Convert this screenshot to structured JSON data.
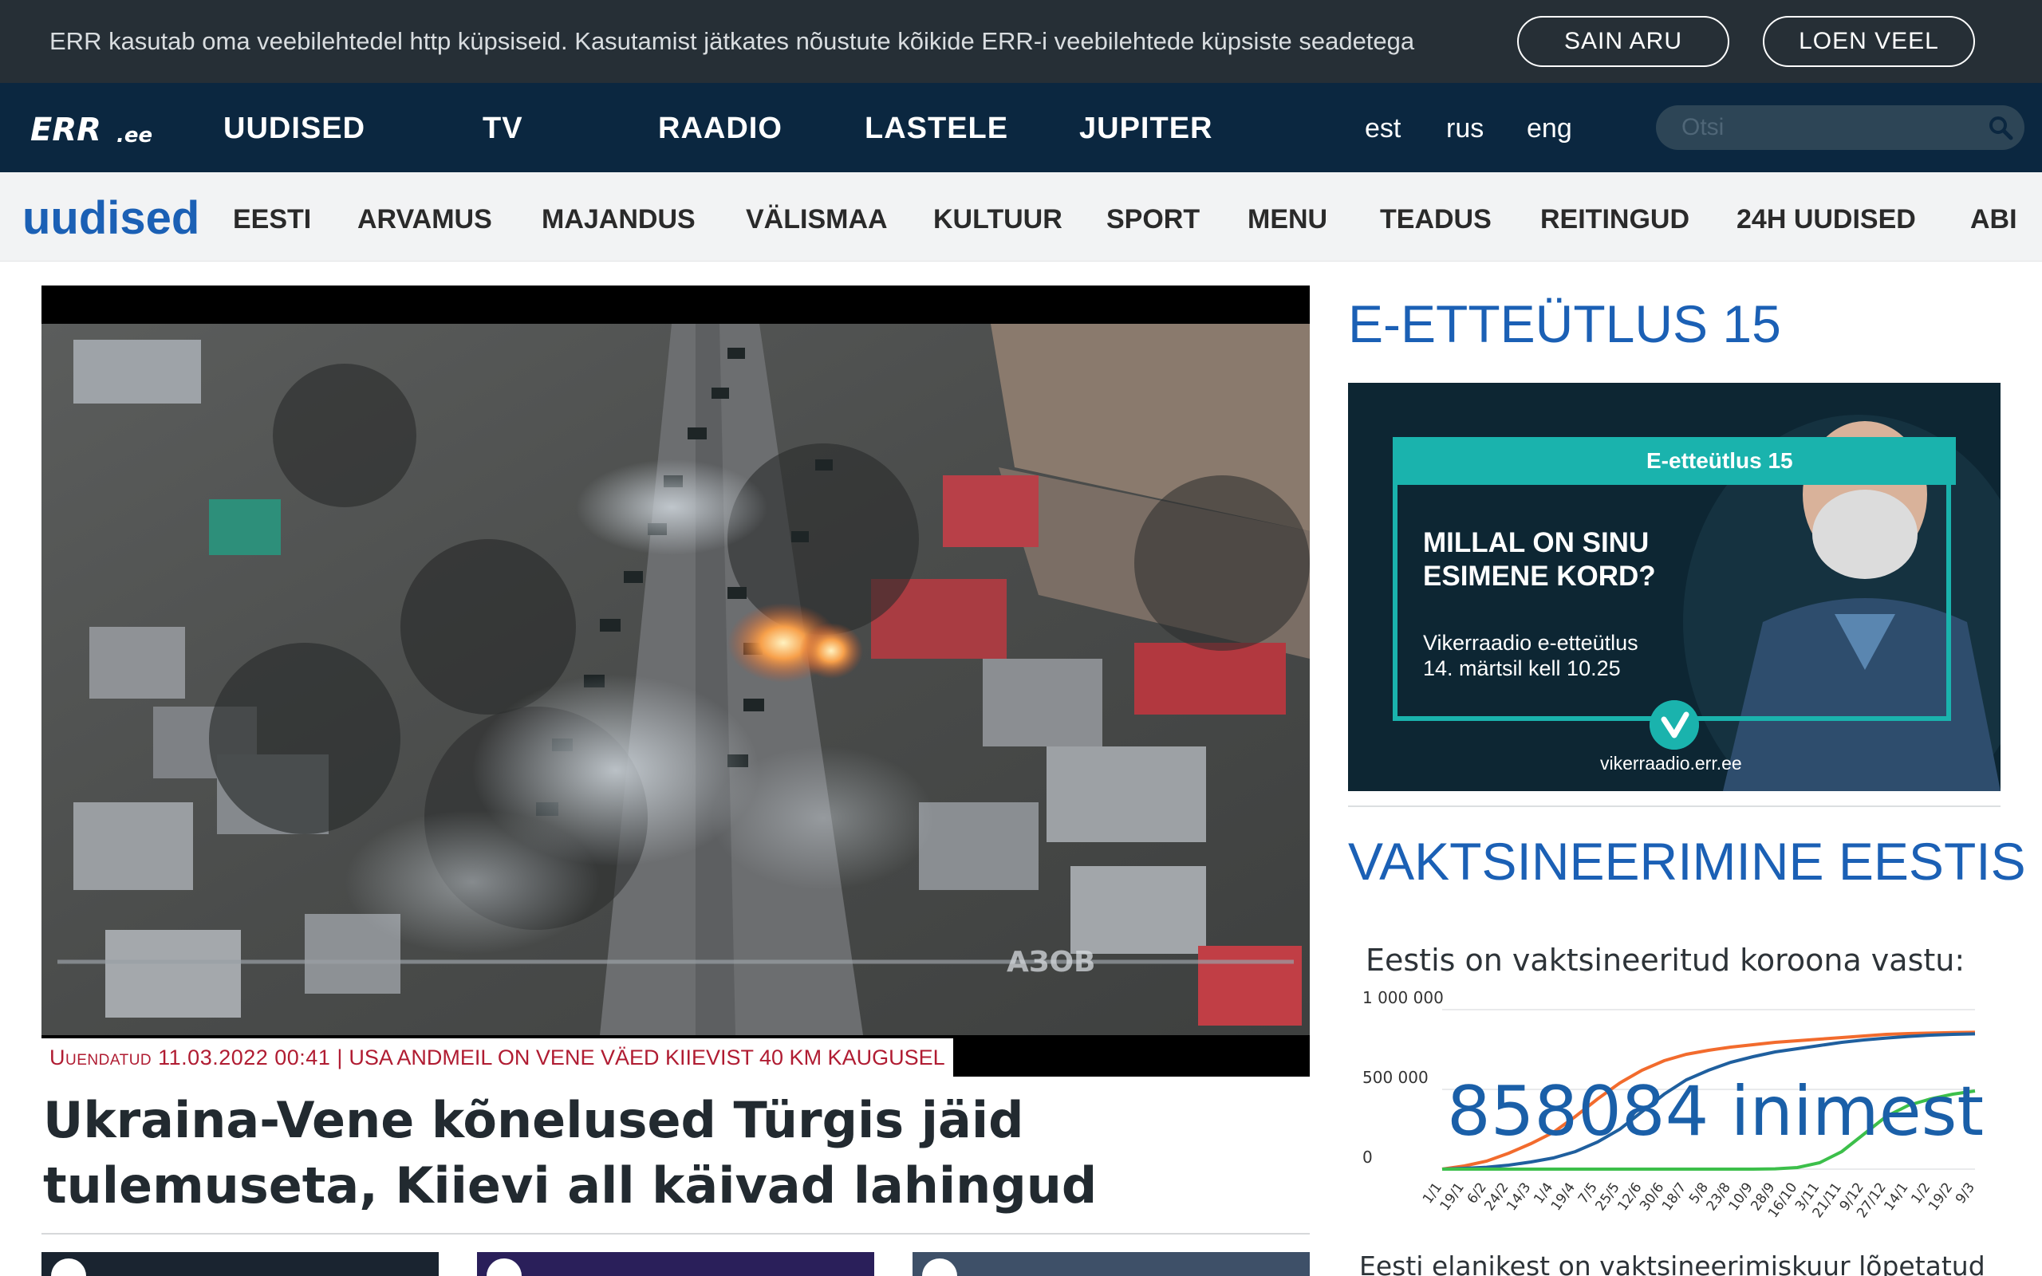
{
  "cookie": {
    "text": "ERR kasutab oma veebilehtedel http küpsiseid. Kasutamist jätkates nõustute kõikide ERR-i veebilehtede küpsiste seadetega",
    "accept_label": "SAIN ARU",
    "more_label": "LOEN VEEL"
  },
  "topnav": {
    "logo_text": "ERR.ee",
    "items": [
      "UUDISED",
      "TV",
      "RAADIO",
      "LASTELE",
      "JUPITER"
    ],
    "languages": [
      "est",
      "rus",
      "eng"
    ],
    "search_placeholder": "Otsi"
  },
  "subnav": {
    "section_title": "uudised",
    "items": [
      "EESTI",
      "ARVAMUS",
      "MAJANDUS",
      "VÄLISMAA",
      "KULTUUR",
      "SPORT",
      "MENU",
      "TEADUS",
      "REITINGUD",
      "24H UUDISED",
      "ABI"
    ]
  },
  "hero": {
    "updated": "Uuendatud 11.03.2022 00:41",
    "separator": "|",
    "caption": "USA ANDMEIL ON VENE VÄED KIIEVIST 40 KM KAUGUSEL",
    "watermark": "АЗОВ",
    "headline": "Ukraina-Vene kõnelused Türgis jäid tulemuseta, Kiievi all käivad lahingud"
  },
  "sidebar": {
    "promo_title": "E-ETTEÜTLUS 15",
    "promo_banner": "E-etteütlus 15",
    "promo_question_1": "MILLAL ON SINU",
    "promo_question_2": "ESIMENE KORD?",
    "promo_date_1": "Vikerraadio e-etteütlus",
    "promo_date_2": "14. märtsil kell 10.25",
    "promo_url": "vikerraadio.err.ee",
    "vacc_title": "VAKTSINEERIMINE EESTIS",
    "vacc_subtitle": "Eestis on vaktsineeritud koroona vastu:",
    "vacc_big_number": "858084 inimest",
    "vacc_footer": "Eesti elanikest on vaktsineerimiskuur lõpetatud"
  },
  "colors": {
    "brand_blue": "#1b60b5",
    "nav_dark": "#0b2740",
    "cookie_bg": "#262f36",
    "caption_red": "#b01c32",
    "promo_teal": "#1ab3ad",
    "series_orange": "#f26b2d",
    "series_blue": "#1f5f9e",
    "series_green": "#3cbf4a"
  },
  "chart_data": {
    "type": "line",
    "title": "Eestis on vaktsineeritud koroona vastu:",
    "ylim": [
      0,
      1000000
    ],
    "yticks": [
      "1 000 000",
      "500 000",
      "0"
    ],
    "ytick_values": [
      1000000,
      500000,
      0
    ],
    "categories": [
      "1/1",
      "19/1",
      "6/2",
      "24/2",
      "14/3",
      "1/4",
      "19/4",
      "7/5",
      "25/5",
      "12/6",
      "30/6",
      "18/7",
      "5/8",
      "23/8",
      "10/9",
      "28/9",
      "16/10",
      "3/11",
      "21/11",
      "9/12",
      "27/12",
      "14/1",
      "1/2",
      "19/2",
      "9/3"
    ],
    "series": [
      {
        "color": "#f26b2d",
        "values": [
          0,
          20000,
          50000,
          100000,
          160000,
          230000,
          330000,
          440000,
          540000,
          620000,
          680000,
          720000,
          745000,
          765000,
          780000,
          795000,
          805000,
          815000,
          825000,
          835000,
          845000,
          850000,
          853000,
          856000,
          858084
        ]
      },
      {
        "color": "#1f5f9e",
        "values": [
          0,
          5000,
          12000,
          25000,
          45000,
          70000,
          110000,
          170000,
          250000,
          360000,
          470000,
          560000,
          620000,
          670000,
          705000,
          735000,
          755000,
          775000,
          795000,
          810000,
          822000,
          832000,
          840000,
          845000,
          848000
        ]
      },
      {
        "color": "#3cbf4a",
        "values": [
          0,
          0,
          0,
          0,
          0,
          0,
          0,
          0,
          0,
          0,
          0,
          0,
          0,
          0,
          0,
          2000,
          10000,
          40000,
          110000,
          220000,
          330000,
          400000,
          440000,
          470000,
          490000
        ]
      }
    ]
  }
}
